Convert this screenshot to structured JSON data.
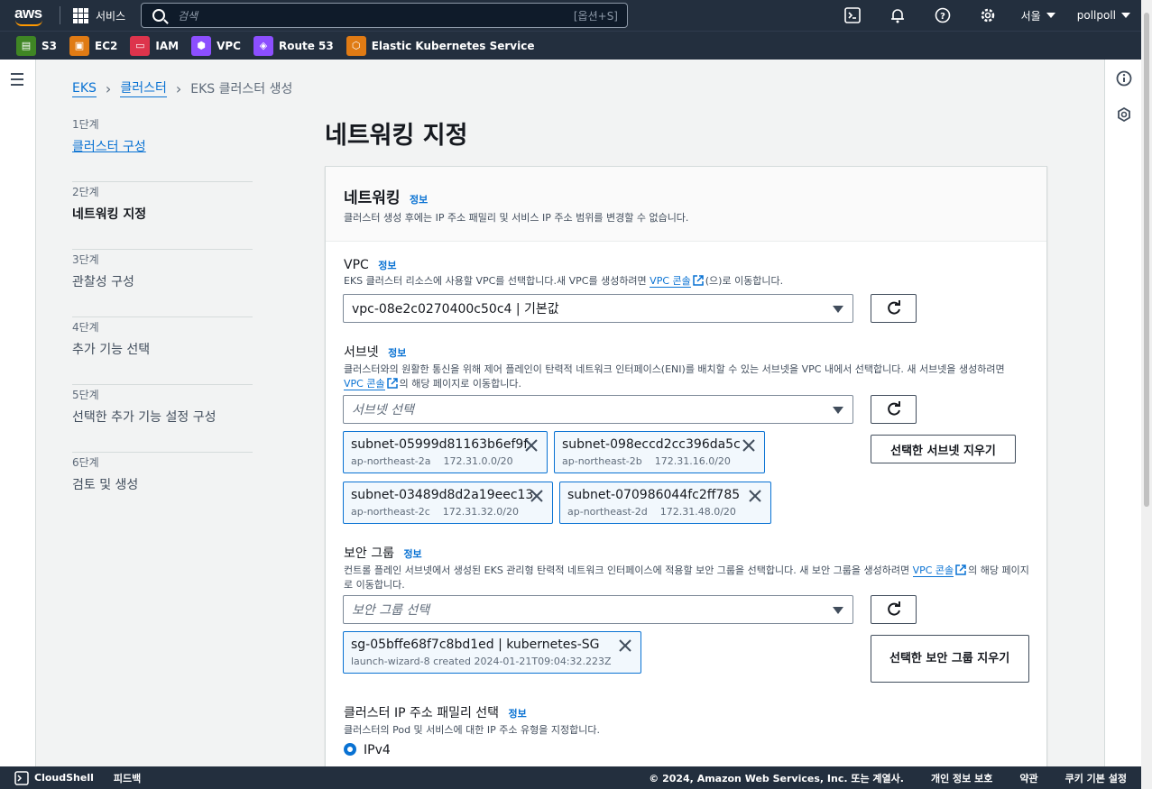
{
  "topnav": {
    "logo": "aws",
    "services_label": "서비스",
    "search_placeholder": "검색",
    "search_shortcut": "[옵션+S]",
    "region": "서울",
    "user": "pollpoll"
  },
  "favorites": [
    {
      "label": "S3",
      "color": "#3f8624",
      "icon": "s3-icon"
    },
    {
      "label": "EC2",
      "color": "#e07b14",
      "icon": "ec2-icon"
    },
    {
      "label": "IAM",
      "color": "#dd344c",
      "icon": "iam-icon"
    },
    {
      "label": "VPC",
      "color": "#8c4fff",
      "icon": "vpc-icon"
    },
    {
      "label": "Route 53",
      "color": "#8c4fff",
      "icon": "route53-icon"
    },
    {
      "label": "Elastic Kubernetes Service",
      "color": "#e07b14",
      "icon": "eks-icon"
    }
  ],
  "breadcrumb": {
    "items": [
      "EKS",
      "클러스터"
    ],
    "current": "EKS 클러스터 생성"
  },
  "steps": [
    {
      "num": "1단계",
      "title": "클러스터 구성"
    },
    {
      "num": "2단계",
      "title": "네트워킹 지정"
    },
    {
      "num": "3단계",
      "title": "관찰성 구성"
    },
    {
      "num": "4단계",
      "title": "추가 기능 선택"
    },
    {
      "num": "5단계",
      "title": "선택한 추가 기능 설정 구성"
    },
    {
      "num": "6단계",
      "title": "검토 및 생성"
    }
  ],
  "page_title": "네트워킹 지정",
  "panel": {
    "title": "네트워킹",
    "info": "정보",
    "desc": "클러스터 생성 후에는 IP 주소 패밀리 및 서비스 IP 주소 범위를 변경할 수 없습니다."
  },
  "vpc": {
    "label": "VPC",
    "info": "정보",
    "desc_pre": "EKS 클러스터 리소스에 사용할 VPC를 선택합니다.새 VPC를 생성하려면 ",
    "desc_link": "VPC 콘솔",
    "desc_post": "(으)로 이동합니다.",
    "value": "vpc-08e2c0270400c50c4 | 기본값"
  },
  "subnet": {
    "label": "서브넷",
    "info": "정보",
    "desc_pre": "클러스터와의 원활한 통신을 위해 제어 플레인이 탄력적 네트워크 인터페이스(ENI)를 배치할 수 있는 서브넷을 VPC 내에서 선택합니다. 새 서브넷을 생성하려면",
    "desc_link": "VPC 콘솔",
    "desc_post": "의 해당 페이지로 이동합니다.",
    "placeholder": "서브넷 선택",
    "clear_button": "선택한 서브넷 지우기",
    "tokens": [
      {
        "id": "subnet-05999d81163b6ef9f",
        "az": "ap-northeast-2a",
        "cidr": "172.31.0.0/20"
      },
      {
        "id": "subnet-098eccd2cc396da5c",
        "az": "ap-northeast-2b",
        "cidr": "172.31.16.0/20"
      },
      {
        "id": "subnet-03489d8d2a19eec13",
        "az": "ap-northeast-2c",
        "cidr": "172.31.32.0/20"
      },
      {
        "id": "subnet-070986044fc2ff785",
        "az": "ap-northeast-2d",
        "cidr": "172.31.48.0/20"
      }
    ]
  },
  "sg": {
    "label": "보안 그룹",
    "info": "정보",
    "desc_pre": "컨트롤 플레인 서브넷에서 생성된 EKS 관리형 탄력적 네트워크 인터페이스에 적용할 보안 그룹을 선택합니다. 새 보안 그룹을 생성하려면 ",
    "desc_link": "VPC 콘솔",
    "desc_post": "의 해당 페이지로 이동합니다.",
    "placeholder": "보안 그룹 선택",
    "clear_button": "선택한 보안 그룹 지우기",
    "token": {
      "title": "sg-05bffe68f7c8bd1ed | kubernetes-SG",
      "sub": "launch-wizard-8 created 2024-01-21T09:04:32.223Z"
    }
  },
  "ipfamily": {
    "label": "클러스터 IP 주소 패밀리 선택",
    "info": "정보",
    "desc": "클러스터의 Pod 및 서비스에 대한 IP 주소 유형을 지정합니다.",
    "option": "IPv4"
  },
  "footer": {
    "cloudshell": "CloudShell",
    "feedback": "피드백",
    "copyright": "© 2024, Amazon Web Services, Inc. 또는 계열사.",
    "privacy": "개인 정보 보호",
    "terms": "약관",
    "cookies": "쿠키 기본 설정"
  }
}
